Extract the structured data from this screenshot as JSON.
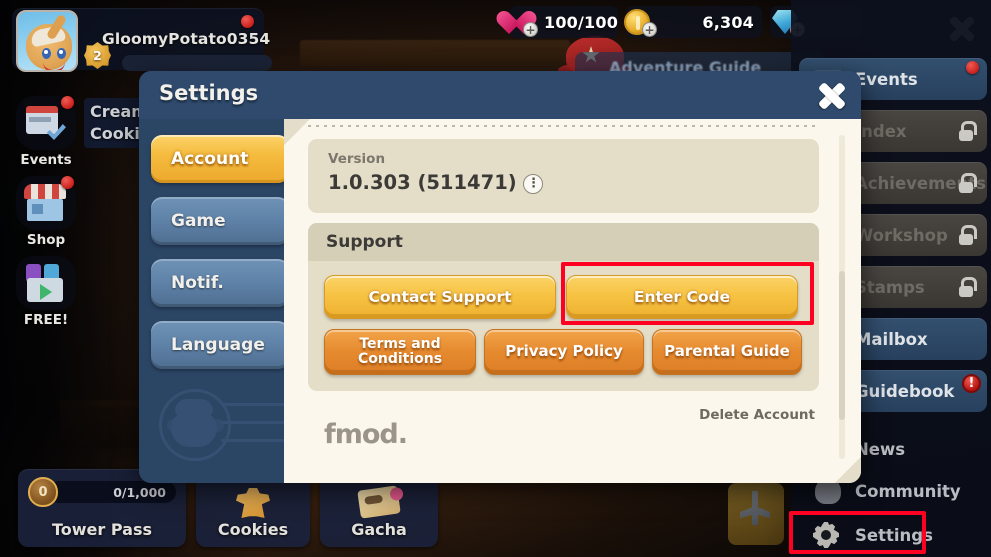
{
  "hud": {
    "player_name": "GloomyPotato0354",
    "level": "2",
    "currencies": [
      {
        "name": "hearts",
        "icon": "heart-icon",
        "value": "100/100",
        "plus": "+"
      },
      {
        "name": "coins",
        "icon": "coin-icon",
        "value": "6,304",
        "plus": "+"
      },
      {
        "name": "gems",
        "icon": "gem-icon",
        "value": "",
        "plus": "+"
      }
    ],
    "close_icon": "close-icon"
  },
  "left_rail": [
    {
      "label": "Events",
      "icon": "calendar-icon",
      "badge": true
    },
    {
      "label": "Shop",
      "icon": "shop-icon",
      "badge": true
    },
    {
      "label": "FREE!",
      "icon": "free-gift-icon",
      "badge": false
    }
  ],
  "lot_banner": {
    "line1": "Cream",
    "line2": "Cookie"
  },
  "background": {
    "adventure_guide": "Adventure Guide"
  },
  "bottom_bar": {
    "tower_pass": {
      "label": "Tower Pass",
      "progress": "0/1,000",
      "coin_value": "0"
    },
    "cookies": {
      "label": "Cookies"
    },
    "gacha": {
      "label": "Gacha"
    }
  },
  "right_menu": {
    "items": [
      {
        "label": "Events",
        "state": "on",
        "badge": "dot",
        "lock": false,
        "icon": "calendar-icon"
      },
      {
        "label": "Index",
        "state": "off",
        "badge": "none",
        "lock": true,
        "icon": "book-icon"
      },
      {
        "label": "Achievements",
        "state": "off",
        "badge": "none",
        "lock": true,
        "icon": "trophy-icon"
      },
      {
        "label": "Workshop",
        "state": "off",
        "badge": "none",
        "lock": true,
        "icon": "hammer-icon"
      },
      {
        "label": "Stamps",
        "state": "off",
        "badge": "none",
        "lock": true,
        "icon": "stamp-icon"
      },
      {
        "label": "Mailbox",
        "state": "on",
        "badge": "none",
        "lock": false,
        "icon": "mail-icon"
      },
      {
        "label": "Guidebook",
        "state": "on",
        "badge": "alert",
        "lock": false,
        "icon": "guidebook-icon"
      },
      {
        "label": "News",
        "state": "plain",
        "badge": "none",
        "lock": false,
        "icon": "news-icon"
      },
      {
        "label": "Community",
        "state": "plain",
        "badge": "none",
        "lock": false,
        "icon": "community-icon"
      },
      {
        "label": "Settings",
        "state": "plain",
        "badge": "none",
        "lock": false,
        "icon": "gear-icon"
      }
    ],
    "alert_symbol": "!"
  },
  "settings_dialog": {
    "title": "Settings",
    "close_icon": "close-icon",
    "tabs": [
      {
        "label": "Account",
        "active": true
      },
      {
        "label": "Game",
        "active": false
      },
      {
        "label": "Notif.",
        "active": false
      },
      {
        "label": "Language",
        "active": false
      }
    ],
    "version": {
      "label": "Version",
      "value": "1.0.303 (511471)",
      "info_icon": "info-icon"
    },
    "support": {
      "header": "Support",
      "buttons": [
        {
          "label": "Contact Support",
          "style": "yellow"
        },
        {
          "label": "Enter Code",
          "style": "yellow",
          "highlighted": true
        },
        {
          "label": "Terms and Conditions",
          "style": "orange"
        },
        {
          "label": "Privacy Policy",
          "style": "orange"
        },
        {
          "label": "Parental Guide",
          "style": "orange"
        }
      ]
    },
    "delete_account": "Delete Account",
    "fmod_logo": "fmod."
  },
  "highlights": {
    "color": "#ff0022",
    "targets": [
      "enter-code-button",
      "settings-menu-item"
    ]
  }
}
